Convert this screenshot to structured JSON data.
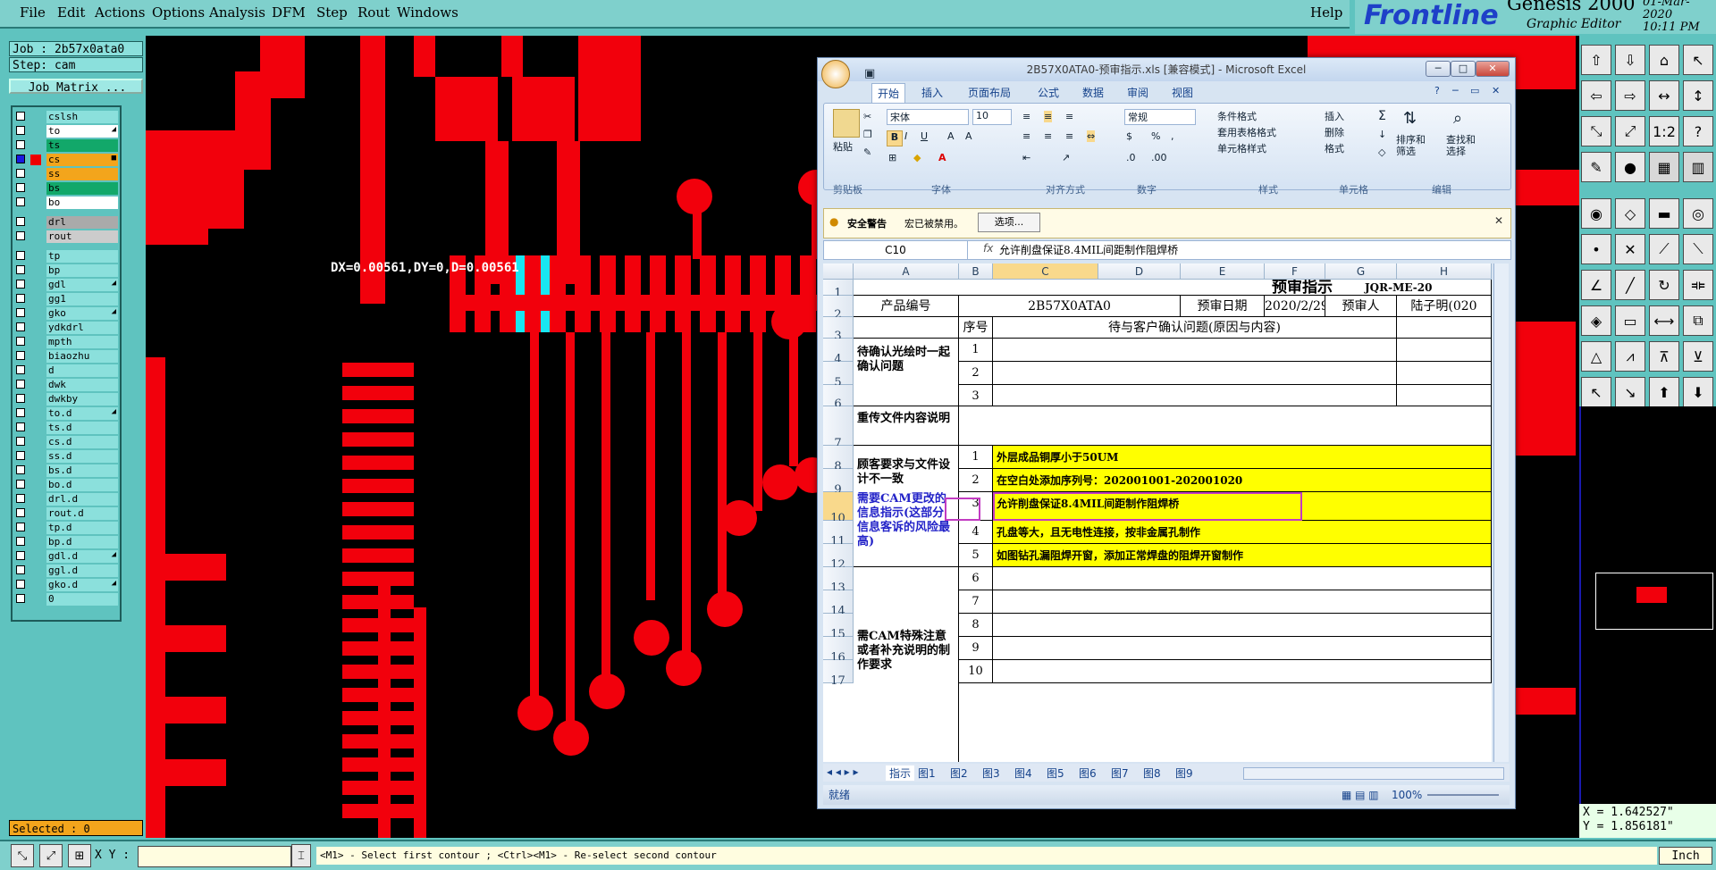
{
  "menu": {
    "items": [
      "File",
      "Edit",
      "Actions",
      "Options",
      "Analysis",
      "DFM",
      "Step",
      "Rout",
      "Windows"
    ],
    "help": "Help"
  },
  "logo": {
    "brand": "Frontline",
    "product": "Genesis 2000",
    "subtitle": "Graphic Editor",
    "date": "01-Mar-2020",
    "time": "10:11 PM"
  },
  "job": {
    "job_label": "Job : 2b57x0ata0",
    "step_label": "Step: cam",
    "matrix_button": "Job Matrix ..."
  },
  "layers": [
    {
      "name": "cslsh"
    },
    {
      "name": "to",
      "mark": "◢",
      "active": true
    },
    {
      "name": "ts"
    },
    {
      "name": "cs",
      "mark": "■",
      "selected": true
    },
    {
      "name": "ss"
    },
    {
      "name": "bs"
    },
    {
      "name": "bo"
    },
    {
      "name": "drl"
    },
    {
      "name": "rout"
    },
    {
      "name": "tp"
    },
    {
      "name": "bp"
    },
    {
      "name": "gdl",
      "mark": "◢"
    },
    {
      "name": "gg1"
    },
    {
      "name": "gko",
      "mark": "◢"
    },
    {
      "name": "ydkdrl"
    },
    {
      "name": "mpth"
    },
    {
      "name": "biaozhu"
    },
    {
      "name": "d"
    },
    {
      "name": "dwk"
    },
    {
      "name": "dwkby"
    },
    {
      "name": "to.d",
      "mark": "◢"
    },
    {
      "name": "ts.d"
    },
    {
      "name": "cs.d"
    },
    {
      "name": "ss.d"
    },
    {
      "name": "bs.d"
    },
    {
      "name": "bo.d"
    },
    {
      "name": "drl.d"
    },
    {
      "name": "rout.d"
    },
    {
      "name": "tp.d"
    },
    {
      "name": "bp.d"
    },
    {
      "name": "gdl.d",
      "mark": "◢"
    },
    {
      "name": "ggl.d"
    },
    {
      "name": "gko.d",
      "mark": "◢"
    },
    {
      "name": "0"
    }
  ],
  "selected": "Selected : 0",
  "measure": {
    "text": "DX=0.00561,DY=0,D=0.00561"
  },
  "coords": {
    "x": "X = 1.642527\"",
    "y": "Y = 1.856181\""
  },
  "status": {
    "xy_label": "X Y :",
    "prompt": "<M1> - Select first contour ; <Ctrl><M1> - Re-select second contour",
    "units": "Inch"
  },
  "excel": {
    "title": "2B57X0ATA0-预审指示.xls [兼容模式] - Microsoft Excel",
    "tabs": [
      "开始",
      "插入",
      "页面布局",
      "公式",
      "数据",
      "审阅",
      "视图"
    ],
    "font_name": "宋体",
    "font_size": "10",
    "number_format": "常规",
    "groups": [
      "剪贴板",
      "字体",
      "对齐方式",
      "数字",
      "样式",
      "单元格",
      "编辑"
    ],
    "ribbon_btns": [
      "粘贴",
      "条件格式",
      "套用表格格式",
      "单元格样式",
      "插入",
      "删除",
      "格式",
      "排序和筛选",
      "查找和选择"
    ],
    "security": {
      "label": "安全警告",
      "text": "宏已被禁用。",
      "button": "选项..."
    },
    "namebox": "C10",
    "formula": "允许削盘保证8.4MIL间距制作阻焊桥",
    "cols": [
      "A",
      "B",
      "C",
      "D",
      "E",
      "F",
      "G",
      "H"
    ],
    "rows": [
      "1",
      "2",
      "3",
      "4",
      "5",
      "6",
      "7",
      "8",
      "9",
      "10",
      "11",
      "12",
      "13",
      "14",
      "15",
      "16",
      "17"
    ],
    "sheet": {
      "title": "预审指示",
      "code": "JQR-ME-20",
      "product_label": "产品编号",
      "product_value": "2B57X0ATA0",
      "date_label": "预审日期",
      "date_value": "2020/2/29",
      "reviewer_label": "预审人",
      "reviewer_value": "陆子明(020",
      "seq_label": "序号",
      "issue_label": "待与客户确认问题(原因与内容)",
      "sec1": "待确认光绘时一起确认问题",
      "sec2": "重传文件内容说明",
      "sec3a": "顾客要求与文件设计不一致",
      "sec3b": "需要CAM更改的信息指示(这部分信息客诉的风险最高)",
      "sec4": "需CAM特殊注意或者补充说明的制作要求",
      "seqs1": [
        "1",
        "2",
        "3"
      ],
      "seqs2": [
        "1",
        "2",
        "3",
        "4",
        "5"
      ],
      "seqs3": [
        "6",
        "7",
        "8",
        "9",
        "10"
      ],
      "notes": [
        "外层成品铜厚小于50UM",
        "在空白处添加序列号：202001001-202001020",
        "允许削盘保证8.4MIL间距制作阻焊桥",
        "孔盘等大，且无电性连接，按非金属孔制作",
        "如图钻孔漏阻焊开窗，添加正常焊盘的阻焊开窗制作"
      ]
    },
    "sheet_tabs": [
      "指示",
      "图1",
      "图2",
      "图3",
      "图4",
      "图5",
      "图6",
      "图7",
      "图8",
      "图9"
    ],
    "status": "就绪",
    "zoom": "100%"
  }
}
